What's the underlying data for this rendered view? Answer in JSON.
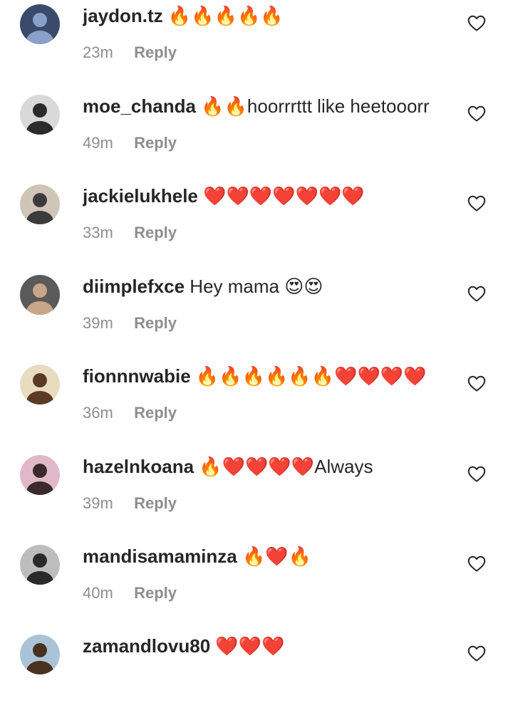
{
  "comments": [
    {
      "username": "jaydon.tz",
      "text": "🔥🔥🔥🔥🔥",
      "time": "23m",
      "reply": "Reply",
      "avatar_bg": "#3a4a6b",
      "avatar_fg": "#8aa0c8"
    },
    {
      "username": "moe_chanda",
      "text": "🔥🔥hoorrrttt like heetooorr",
      "time": "49m",
      "reply": "Reply",
      "avatar_bg": "#d9d9d9",
      "avatar_fg": "#2b2b2b"
    },
    {
      "username": "jackielukhele",
      "text": "❤️❤️❤️❤️❤️❤️❤️",
      "time": "33m",
      "reply": "Reply",
      "avatar_bg": "#cfc6b8",
      "avatar_fg": "#3b3b3b"
    },
    {
      "username": "diimplefxce",
      "text": "Hey mama 😍😍",
      "time": "39m",
      "reply": "Reply",
      "avatar_bg": "#5a5a5a",
      "avatar_fg": "#c9a58a"
    },
    {
      "username": "fionnnwabie",
      "text": "🔥🔥🔥🔥🔥🔥❤️❤️❤️❤️",
      "time": "36m",
      "reply": "Reply",
      "avatar_bg": "#e8dcc0",
      "avatar_fg": "#5a3a22"
    },
    {
      "username": "hazelnkoana",
      "text": "🔥❤️❤️❤️❤️Always",
      "time": "39m",
      "reply": "Reply",
      "avatar_bg": "#e0b8c8",
      "avatar_fg": "#3a2a2a"
    },
    {
      "username": "mandisamaminza",
      "text": "🔥❤️🔥",
      "time": "40m",
      "reply": "Reply",
      "avatar_bg": "#bdbdbd",
      "avatar_fg": "#2a2a2a"
    },
    {
      "username": "zamandlovu80",
      "text": "❤️❤️❤️",
      "time": "",
      "reply": "",
      "avatar_bg": "#a9c4d6",
      "avatar_fg": "#4a3020"
    }
  ],
  "icons": {
    "like": "heart-outline-icon"
  }
}
